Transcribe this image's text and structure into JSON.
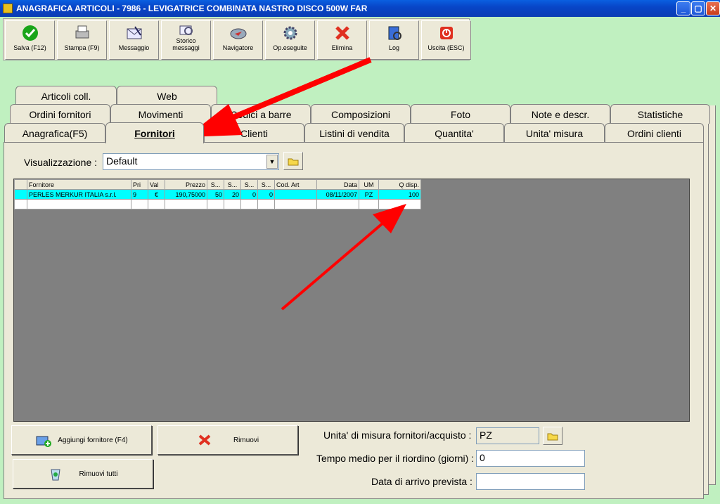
{
  "window": {
    "title": "ANAGRAFICA ARTICOLI - 7986 - LEVIGATRICE COMBINATA NASTRO DISCO 500W FAR",
    "controls": [
      "_",
      "▢",
      "✕"
    ]
  },
  "toolbar": {
    "buttons": [
      {
        "label": "Salva (F12)",
        "icon": "check-icon"
      },
      {
        "label": "Stampa (F9)",
        "icon": "printer-icon"
      },
      {
        "label": "Messaggio",
        "icon": "envelope-icon"
      },
      {
        "label": "Storico messaggi",
        "icon": "history-icon"
      },
      {
        "label": "Navigatore",
        "icon": "compass-icon"
      },
      {
        "label": "Op.eseguite",
        "icon": "gear-icon"
      },
      {
        "label": "Elimina",
        "icon": "delete-icon"
      },
      {
        "label": "Log",
        "icon": "log-icon"
      },
      {
        "label": "Uscita (ESC)",
        "icon": "exit-icon"
      }
    ]
  },
  "tabs": {
    "row1": [
      "Articoli coll.",
      "Web"
    ],
    "row2": [
      "Ordini fornitori",
      "Movimenti",
      "Codici a barre",
      "Composizioni",
      "Foto",
      "Note e descr.",
      "Statistiche"
    ],
    "row3": [
      "Anagrafica(F5)",
      "Fornitori",
      "Clienti",
      "Listini di vendita",
      "Quantita'",
      "Unita' misura",
      "Ordini clienti"
    ],
    "active": "Fornitori"
  },
  "view": {
    "label": "Visualizzazione :",
    "value": "Default"
  },
  "grid": {
    "columns": [
      "Fornitore",
      "Pri",
      "Val",
      "Prezzo",
      "S...",
      "S...",
      "S...",
      "S...",
      "Cod. Art",
      "Data",
      "UM",
      "Q disp."
    ],
    "rows": [
      [
        "PERLES MERKUR ITALIA s.r.l.",
        "9",
        "€",
        "190,75000",
        "50",
        "20",
        "0",
        "0",
        "",
        "08/11/2007",
        "PZ",
        "100"
      ]
    ]
  },
  "buttons": {
    "add": "Aggiungi fornitore (F4)",
    "remove": "Rimuovi",
    "remove_all": "Rimuovi tutti"
  },
  "form": {
    "um_label": "Unita' di misura fornitori/acquisto :",
    "um_value": "PZ",
    "lead_label": "Tempo medio per il riordino (giorni) :",
    "lead_value": "0",
    "arrival_label": "Data di arrivo prevista :",
    "arrival_value": ""
  },
  "colors": {
    "selected_row": "#00ffff",
    "annotation_arrow": "#ff0000",
    "background": "#c0f0c0"
  }
}
